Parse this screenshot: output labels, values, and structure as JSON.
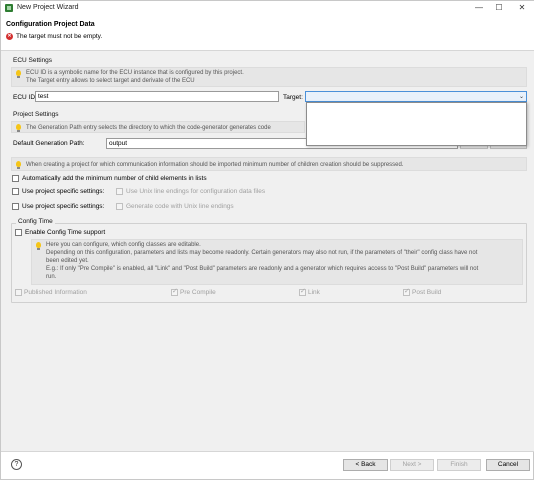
{
  "window": {
    "title": "New Project Wizard",
    "minimize": "—",
    "maximize": "☐",
    "close": "✕"
  },
  "header": {
    "title": "Configuration Project Data",
    "error_message": "The target must not be empty."
  },
  "ecu_settings": {
    "label": "ECU Settings",
    "info_line1": "ECU ID is a symbolic name for the ECU instance that is configured by this project.",
    "info_line2": "The Target entry allows to select target and derivate of the ECU",
    "ecu_id_label": "ECU ID:",
    "ecu_id_value": "test",
    "target_label": "Target:",
    "target_value": ""
  },
  "project_settings": {
    "label": "Project Settings",
    "info": "The Generation Path entry selects the directory to which the code-generator generates code",
    "gen_path_label": "Default Generation Path:",
    "gen_path_value": "output",
    "child_info": "When creating a project for which communication information should be imported minimum number of children creation should be suppressed.",
    "auto_add_label": "Automatically add the minimum number of child elements in lists",
    "use_specific_1": "Use project specific settings:",
    "unix_config_label": "Use Unix line endings for configuration data files",
    "use_specific_2": "Use project specific settings:",
    "unix_code_label": "Generate code with Unix line endings"
  },
  "config_time": {
    "label": "Config Time",
    "enable_label": "Enable Config Time support",
    "info_line1": "Here you can configure, which config classes are editable.",
    "info_line2": "Depending on this configuration, parameters and lists may become readonly. Certain generators may also not run, if the parameters of \"their\" config class have not",
    "info_line3": "been edited yet.",
    "info_line4": "E.g.: If only \"Pre Compile\" is enabled, all \"Link\" and \"Post Build\" parameters are readonly and a generator which requires access to \"Post Build\" parameters will not",
    "info_line5": "run.",
    "classes": [
      "Published Information",
      "Pre Compile",
      "Link",
      "Post Build"
    ]
  },
  "footer": {
    "help": "?",
    "back": "< Back",
    "next": "Next >",
    "finish": "Finish",
    "cancel": "Cancel"
  }
}
